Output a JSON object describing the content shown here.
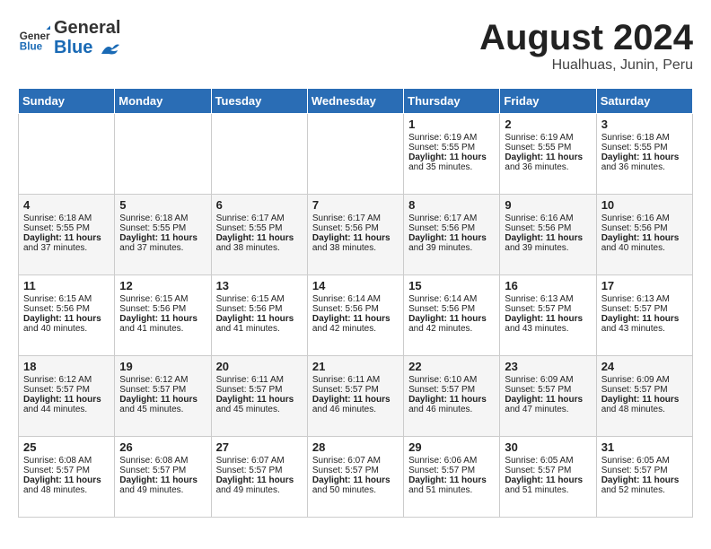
{
  "header": {
    "logo_general": "General",
    "logo_blue": "Blue",
    "title": "August 2024",
    "location": "Hualhuas, Junin, Peru"
  },
  "weekdays": [
    "Sunday",
    "Monday",
    "Tuesday",
    "Wednesday",
    "Thursday",
    "Friday",
    "Saturday"
  ],
  "weeks": [
    [
      {
        "day": "",
        "content": ""
      },
      {
        "day": "",
        "content": ""
      },
      {
        "day": "",
        "content": ""
      },
      {
        "day": "",
        "content": ""
      },
      {
        "day": "1",
        "content": "Sunrise: 6:19 AM\nSunset: 5:55 PM\nDaylight: 11 hours\nand 35 minutes."
      },
      {
        "day": "2",
        "content": "Sunrise: 6:19 AM\nSunset: 5:55 PM\nDaylight: 11 hours\nand 36 minutes."
      },
      {
        "day": "3",
        "content": "Sunrise: 6:18 AM\nSunset: 5:55 PM\nDaylight: 11 hours\nand 36 minutes."
      }
    ],
    [
      {
        "day": "4",
        "content": "Sunrise: 6:18 AM\nSunset: 5:55 PM\nDaylight: 11 hours\nand 37 minutes."
      },
      {
        "day": "5",
        "content": "Sunrise: 6:18 AM\nSunset: 5:55 PM\nDaylight: 11 hours\nand 37 minutes."
      },
      {
        "day": "6",
        "content": "Sunrise: 6:17 AM\nSunset: 5:55 PM\nDaylight: 11 hours\nand 38 minutes."
      },
      {
        "day": "7",
        "content": "Sunrise: 6:17 AM\nSunset: 5:56 PM\nDaylight: 11 hours\nand 38 minutes."
      },
      {
        "day": "8",
        "content": "Sunrise: 6:17 AM\nSunset: 5:56 PM\nDaylight: 11 hours\nand 39 minutes."
      },
      {
        "day": "9",
        "content": "Sunrise: 6:16 AM\nSunset: 5:56 PM\nDaylight: 11 hours\nand 39 minutes."
      },
      {
        "day": "10",
        "content": "Sunrise: 6:16 AM\nSunset: 5:56 PM\nDaylight: 11 hours\nand 40 minutes."
      }
    ],
    [
      {
        "day": "11",
        "content": "Sunrise: 6:15 AM\nSunset: 5:56 PM\nDaylight: 11 hours\nand 40 minutes."
      },
      {
        "day": "12",
        "content": "Sunrise: 6:15 AM\nSunset: 5:56 PM\nDaylight: 11 hours\nand 41 minutes."
      },
      {
        "day": "13",
        "content": "Sunrise: 6:15 AM\nSunset: 5:56 PM\nDaylight: 11 hours\nand 41 minutes."
      },
      {
        "day": "14",
        "content": "Sunrise: 6:14 AM\nSunset: 5:56 PM\nDaylight: 11 hours\nand 42 minutes."
      },
      {
        "day": "15",
        "content": "Sunrise: 6:14 AM\nSunset: 5:56 PM\nDaylight: 11 hours\nand 42 minutes."
      },
      {
        "day": "16",
        "content": "Sunrise: 6:13 AM\nSunset: 5:57 PM\nDaylight: 11 hours\nand 43 minutes."
      },
      {
        "day": "17",
        "content": "Sunrise: 6:13 AM\nSunset: 5:57 PM\nDaylight: 11 hours\nand 43 minutes."
      }
    ],
    [
      {
        "day": "18",
        "content": "Sunrise: 6:12 AM\nSunset: 5:57 PM\nDaylight: 11 hours\nand 44 minutes."
      },
      {
        "day": "19",
        "content": "Sunrise: 6:12 AM\nSunset: 5:57 PM\nDaylight: 11 hours\nand 45 minutes."
      },
      {
        "day": "20",
        "content": "Sunrise: 6:11 AM\nSunset: 5:57 PM\nDaylight: 11 hours\nand 45 minutes."
      },
      {
        "day": "21",
        "content": "Sunrise: 6:11 AM\nSunset: 5:57 PM\nDaylight: 11 hours\nand 46 minutes."
      },
      {
        "day": "22",
        "content": "Sunrise: 6:10 AM\nSunset: 5:57 PM\nDaylight: 11 hours\nand 46 minutes."
      },
      {
        "day": "23",
        "content": "Sunrise: 6:09 AM\nSunset: 5:57 PM\nDaylight: 11 hours\nand 47 minutes."
      },
      {
        "day": "24",
        "content": "Sunrise: 6:09 AM\nSunset: 5:57 PM\nDaylight: 11 hours\nand 48 minutes."
      }
    ],
    [
      {
        "day": "25",
        "content": "Sunrise: 6:08 AM\nSunset: 5:57 PM\nDaylight: 11 hours\nand 48 minutes."
      },
      {
        "day": "26",
        "content": "Sunrise: 6:08 AM\nSunset: 5:57 PM\nDaylight: 11 hours\nand 49 minutes."
      },
      {
        "day": "27",
        "content": "Sunrise: 6:07 AM\nSunset: 5:57 PM\nDaylight: 11 hours\nand 49 minutes."
      },
      {
        "day": "28",
        "content": "Sunrise: 6:07 AM\nSunset: 5:57 PM\nDaylight: 11 hours\nand 50 minutes."
      },
      {
        "day": "29",
        "content": "Sunrise: 6:06 AM\nSunset: 5:57 PM\nDaylight: 11 hours\nand 51 minutes."
      },
      {
        "day": "30",
        "content": "Sunrise: 6:05 AM\nSunset: 5:57 PM\nDaylight: 11 hours\nand 51 minutes."
      },
      {
        "day": "31",
        "content": "Sunrise: 6:05 AM\nSunset: 5:57 PM\nDaylight: 11 hours\nand 52 minutes."
      }
    ]
  ]
}
